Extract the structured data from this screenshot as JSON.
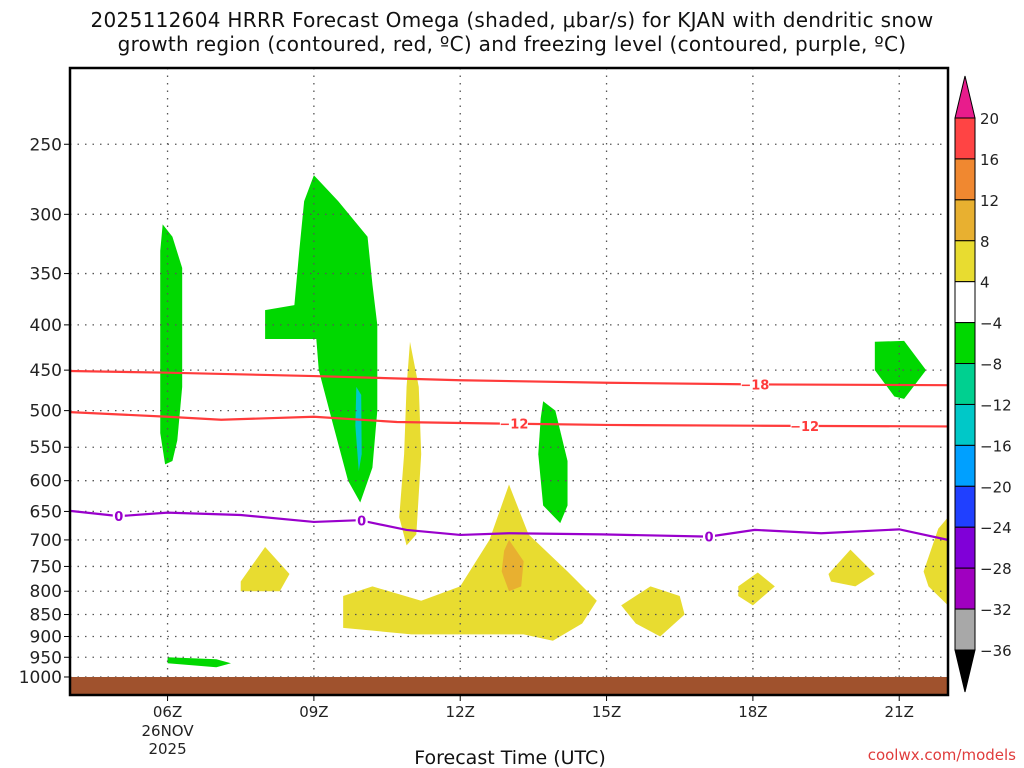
{
  "chart_data": {
    "type": "heatmap",
    "title_line1": "2025112604 HRRR Forecast Omega (shaded, μbar/s) for KJAN with dendritic snow",
    "title_line2": "growth region (contoured, red, ºC) and freezing level (contoured, purple, ºC)",
    "xlabel": "Forecast Time (UTC)",
    "watermark": "coolwx.com/models",
    "xlim_hours": [
      4,
      22
    ],
    "ylim_hPa": [
      205,
      1048
    ],
    "y_scale": "log",
    "x_ticks": [
      {
        "h": 6,
        "label": "06Z"
      },
      {
        "h": 9,
        "label": "09Z"
      },
      {
        "h": 12,
        "label": "12Z"
      },
      {
        "h": 15,
        "label": "15Z"
      },
      {
        "h": 18,
        "label": "18Z"
      },
      {
        "h": 21,
        "label": "21Z"
      }
    ],
    "x_date_line1": "26NOV",
    "x_date_line2": "2025",
    "y_ticks": [
      250,
      300,
      350,
      400,
      450,
      500,
      550,
      600,
      650,
      700,
      750,
      800,
      850,
      900,
      950,
      1000
    ],
    "grid": true,
    "colorbar": {
      "labels": [
        "20",
        "16",
        "12",
        "8",
        "4",
        "-4",
        "-8",
        "-12",
        "-16",
        "-20",
        "-24",
        "-28",
        "-32",
        "-36"
      ],
      "colors": [
        "#ff4444",
        "#f08830",
        "#e8b030",
        "#e8dc30",
        "#ffffff",
        "#00d800",
        "#00d090",
        "#00c8c8",
        "#00a0ff",
        "#2040ff",
        "#8000d8",
        "#a000c0",
        "#a8a8a8"
      ],
      "over_color": "#e81c8c",
      "under_color": "#000000"
    },
    "terrain": {
      "color": "#a0522d",
      "top_hPa": 1000
    },
    "shaded_regions": [
      {
        "class": "-8..-4",
        "color": "#00d800",
        "points": [
          [
            5.9,
            308
          ],
          [
            6.1,
            318
          ],
          [
            6.3,
            345
          ],
          [
            6.3,
            470
          ],
          [
            6.2,
            540
          ],
          [
            6.1,
            570
          ],
          [
            5.95,
            575
          ],
          [
            5.85,
            530
          ],
          [
            5.85,
            330
          ]
        ]
      },
      {
        "class": "-8..-4",
        "color": "#00d800",
        "points": [
          [
            9.0,
            271
          ],
          [
            9.5,
            290
          ],
          [
            10.1,
            318
          ],
          [
            10.2,
            360
          ],
          [
            10.3,
            400
          ],
          [
            10.3,
            500
          ],
          [
            10.2,
            580
          ],
          [
            9.95,
            635
          ],
          [
            9.7,
            600
          ],
          [
            9.4,
            520
          ],
          [
            9.1,
            450
          ],
          [
            9.05,
            415
          ],
          [
            8.0,
            415
          ],
          [
            8.0,
            385
          ],
          [
            8.6,
            380
          ],
          [
            8.7,
            330
          ],
          [
            8.8,
            290
          ]
        ]
      },
      {
        "class": "-16..-12",
        "color": "#00c8c8",
        "points": [
          [
            9.87,
            470
          ],
          [
            9.97,
            480
          ],
          [
            9.98,
            560
          ],
          [
            9.92,
            585
          ],
          [
            9.85,
            520
          ]
        ]
      },
      {
        "class": "4..8",
        "color": "#e8dc30",
        "points": [
          [
            10.97,
            418
          ],
          [
            11.15,
            470
          ],
          [
            11.2,
            560
          ],
          [
            11.1,
            690
          ],
          [
            10.9,
            710
          ],
          [
            10.75,
            660
          ],
          [
            10.85,
            560
          ],
          [
            10.9,
            470
          ]
        ]
      },
      {
        "class": "-8..-4",
        "color": "#00d800",
        "points": [
          [
            13.7,
            488
          ],
          [
            13.95,
            500
          ],
          [
            14.2,
            570
          ],
          [
            14.2,
            640
          ],
          [
            14.05,
            670
          ],
          [
            13.7,
            640
          ],
          [
            13.6,
            560
          ],
          [
            13.65,
            510
          ]
        ]
      },
      {
        "class": "-8..-4",
        "color": "#00d800",
        "points": [
          [
            20.5,
            418
          ],
          [
            21.1,
            417
          ],
          [
            21.55,
            450
          ],
          [
            21.1,
            485
          ],
          [
            20.9,
            482
          ],
          [
            20.5,
            450
          ]
        ]
      },
      {
        "class": "-8..-4",
        "color": "#00d800",
        "points": [
          [
            6.0,
            950
          ],
          [
            7.0,
            955
          ],
          [
            7.3,
            965
          ],
          [
            7.0,
            975
          ],
          [
            6.0,
            965
          ]
        ]
      },
      {
        "class": "4..8",
        "color": "#e8dc30",
        "points": [
          [
            9.6,
            810
          ],
          [
            10.2,
            790
          ],
          [
            11.2,
            820
          ],
          [
            12.0,
            790
          ],
          [
            12.6,
            700
          ],
          [
            13.0,
            606
          ],
          [
            13.4,
            690
          ],
          [
            14.2,
            760
          ],
          [
            14.8,
            820
          ],
          [
            14.5,
            870
          ],
          [
            13.9,
            910
          ],
          [
            13.3,
            895
          ],
          [
            11.0,
            895
          ],
          [
            9.6,
            880
          ]
        ]
      },
      {
        "class": "8..12",
        "color": "#e8b030",
        "points": [
          [
            13.0,
            700
          ],
          [
            13.3,
            740
          ],
          [
            13.25,
            790
          ],
          [
            13.0,
            800
          ],
          [
            12.85,
            760
          ],
          [
            12.9,
            720
          ]
        ]
      },
      {
        "class": "4..8",
        "color": "#e8dc30",
        "points": [
          [
            7.5,
            780
          ],
          [
            8.0,
            713
          ],
          [
            8.5,
            765
          ],
          [
            8.3,
            800
          ],
          [
            7.5,
            800
          ]
        ]
      },
      {
        "class": "4..8",
        "color": "#e8dc30",
        "points": [
          [
            15.3,
            830
          ],
          [
            15.9,
            790
          ],
          [
            16.5,
            810
          ],
          [
            16.6,
            850
          ],
          [
            16.1,
            900
          ],
          [
            15.6,
            870
          ]
        ]
      },
      {
        "class": "4..8",
        "color": "#e8dc30",
        "points": [
          [
            17.7,
            790
          ],
          [
            18.1,
            762
          ],
          [
            18.45,
            790
          ],
          [
            18.0,
            830
          ],
          [
            17.7,
            810
          ]
        ]
      },
      {
        "class": "4..8",
        "color": "#e8dc30",
        "points": [
          [
            19.55,
            765
          ],
          [
            20.0,
            718
          ],
          [
            20.5,
            765
          ],
          [
            20.1,
            790
          ],
          [
            19.6,
            780
          ]
        ]
      },
      {
        "class": "4..8",
        "color": "#e8dc30",
        "points": [
          [
            21.5,
            760
          ],
          [
            21.8,
            680
          ],
          [
            22,
            660
          ],
          [
            22,
            830
          ],
          [
            21.6,
            790
          ]
        ]
      }
    ],
    "contours": [
      {
        "name": "-18",
        "color": "#ff3b3b",
        "label": "-18",
        "label_h": 18.04,
        "points": [
          [
            4,
            451
          ],
          [
            6,
            453
          ],
          [
            9,
            457
          ],
          [
            12,
            462
          ],
          [
            15,
            465
          ],
          [
            18,
            467
          ],
          [
            22,
            468
          ]
        ]
      },
      {
        "name": "-12",
        "color": "#ff3b3b",
        "label": "-12",
        "label_h": 13.1,
        "label2_h": 19.06,
        "points": [
          [
            4,
            502
          ],
          [
            6,
            508
          ],
          [
            7.1,
            512
          ],
          [
            9,
            508
          ],
          [
            10.7,
            515
          ],
          [
            12.7,
            517
          ],
          [
            15,
            519
          ],
          [
            18,
            520
          ],
          [
            22,
            521
          ]
        ]
      },
      {
        "name": "0",
        "color": "#9900cc",
        "label": "0",
        "label_h": 5.0,
        "label2_h": 9.98,
        "label3_h": 17.1,
        "points": [
          [
            4,
            649
          ],
          [
            5,
            658
          ],
          [
            6,
            652
          ],
          [
            7.5,
            656
          ],
          [
            9,
            668
          ],
          [
            9.94,
            665
          ],
          [
            10.9,
            682
          ],
          [
            12,
            691
          ],
          [
            13,
            688
          ],
          [
            14.9,
            690
          ],
          [
            17.1,
            694
          ],
          [
            18.04,
            682
          ],
          [
            19.4,
            688
          ],
          [
            21.0,
            681
          ],
          [
            22,
            700
          ]
        ]
      }
    ]
  }
}
